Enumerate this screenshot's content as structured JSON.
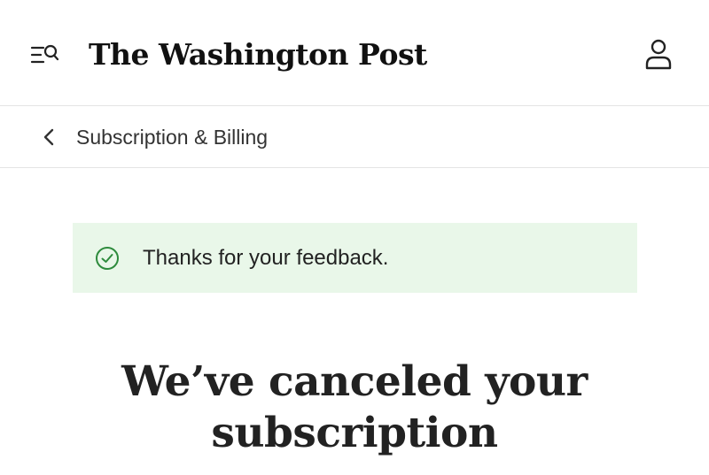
{
  "header": {
    "masthead": "The Washington Post",
    "menu_search_icon": "menu-search-icon",
    "account_icon": "user-icon"
  },
  "subnav": {
    "back_icon": "chevron-left-icon",
    "title": "Subscription & Billing"
  },
  "notice": {
    "icon": "check-circle-icon",
    "text": "Thanks for your feedback.",
    "background_color": "#e9f7e9",
    "icon_color": "#2e8b3d"
  },
  "main": {
    "headline_line1": "We’ve canceled your",
    "headline_line2": "subscription"
  }
}
